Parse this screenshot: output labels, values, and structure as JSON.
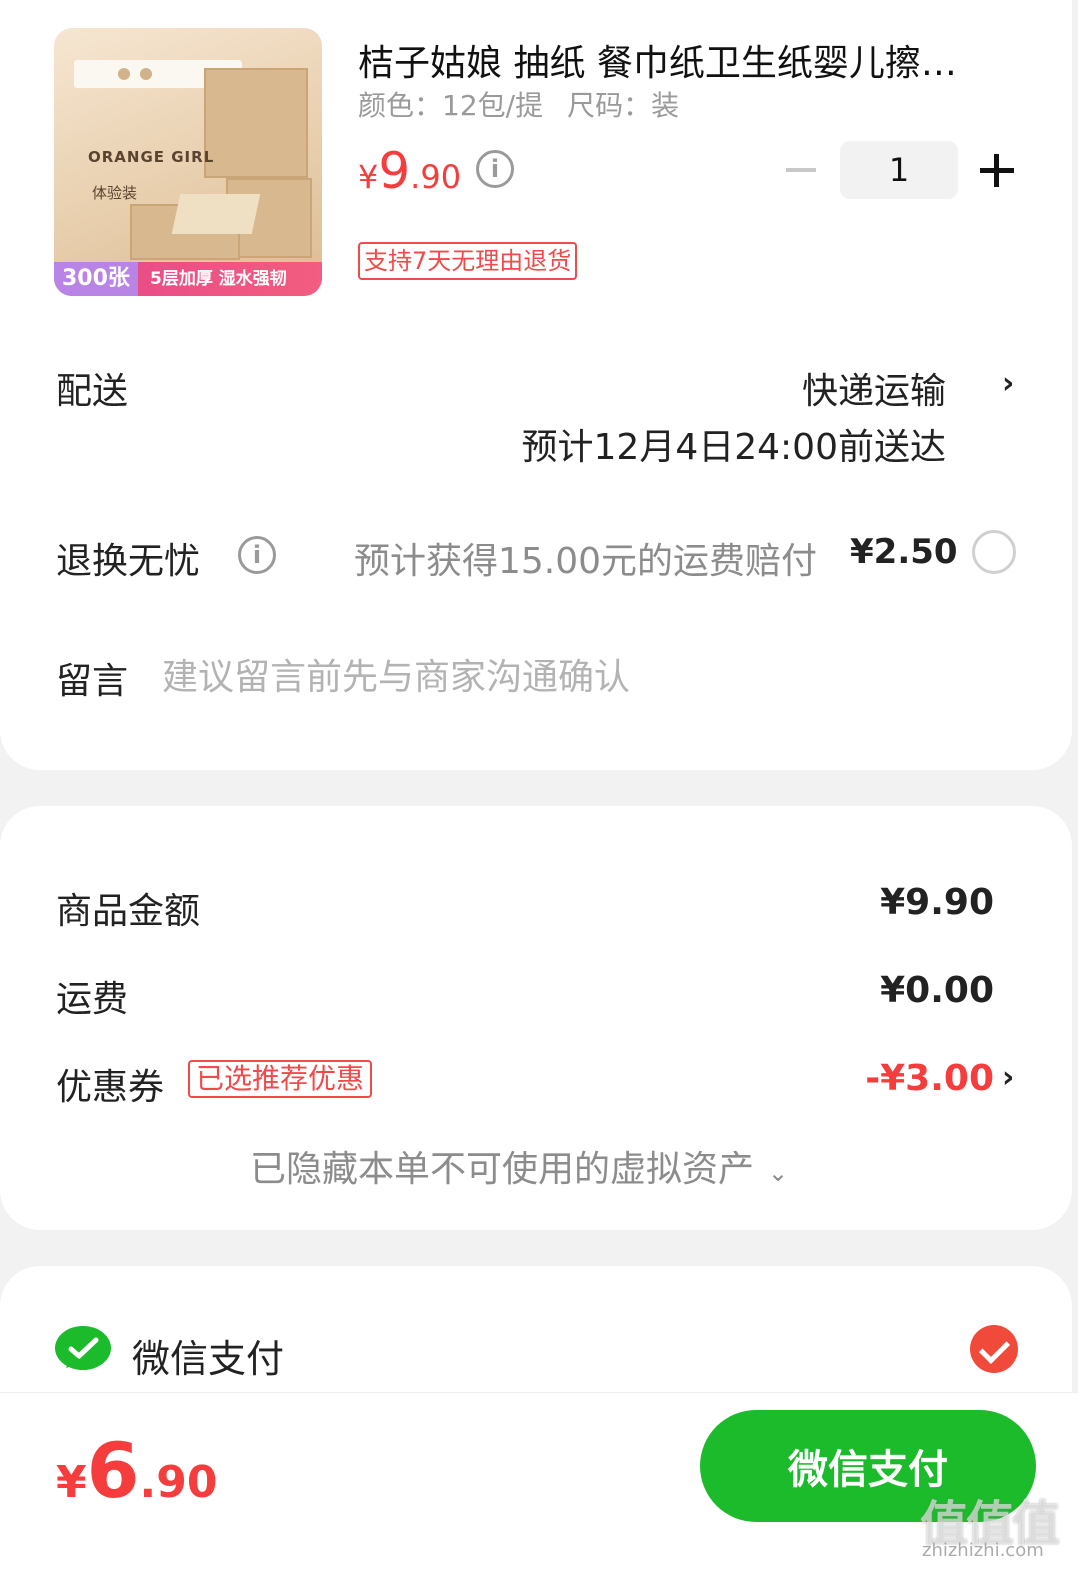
{
  "product": {
    "title": "桔子姑娘 抽纸 餐巾纸卫生纸婴儿擦…",
    "color_spec": "颜色：12包/提",
    "size_spec": "尺码：装",
    "price_currency": "¥",
    "price_int": "9",
    "price_dec": ".90",
    "quantity": "1",
    "return_policy": "支持7天无理由退货",
    "image": {
      "brand_text": "ORANGE GIRL",
      "trial_text": "体验装",
      "badge_count": "300张",
      "badge_features": "5层加厚 湿水强韧"
    }
  },
  "delivery": {
    "label": "配送",
    "method": "快递运输",
    "eta": "预计12月4日24:00前送达"
  },
  "return_insurance": {
    "label": "退换无忧",
    "description": "预计获得15.00元的运费赔付",
    "price": "¥2.50"
  },
  "message": {
    "label": "留言",
    "placeholder": "建议留言前先与商家沟通确认"
  },
  "summary": {
    "goods_label": "商品金额",
    "goods_amount": "¥9.90",
    "shipping_label": "运费",
    "shipping_amount": "¥0.00",
    "coupon_label": "优惠券",
    "coupon_tag": "已选推荐优惠",
    "coupon_amount": "-¥3.00",
    "hidden_assets": "已隐藏本单不可使用的虚拟资产"
  },
  "payment": {
    "method_label": "微信支付"
  },
  "footer": {
    "total_currency": "¥",
    "total_int": "6",
    "total_dec": ".90",
    "pay_button": "微信支付",
    "watermark": "值值值",
    "watermark_url": "zhizhizhi.com"
  },
  "colors": {
    "accent_red": "#f53d3d",
    "wechat_green": "#1cbb2b"
  }
}
